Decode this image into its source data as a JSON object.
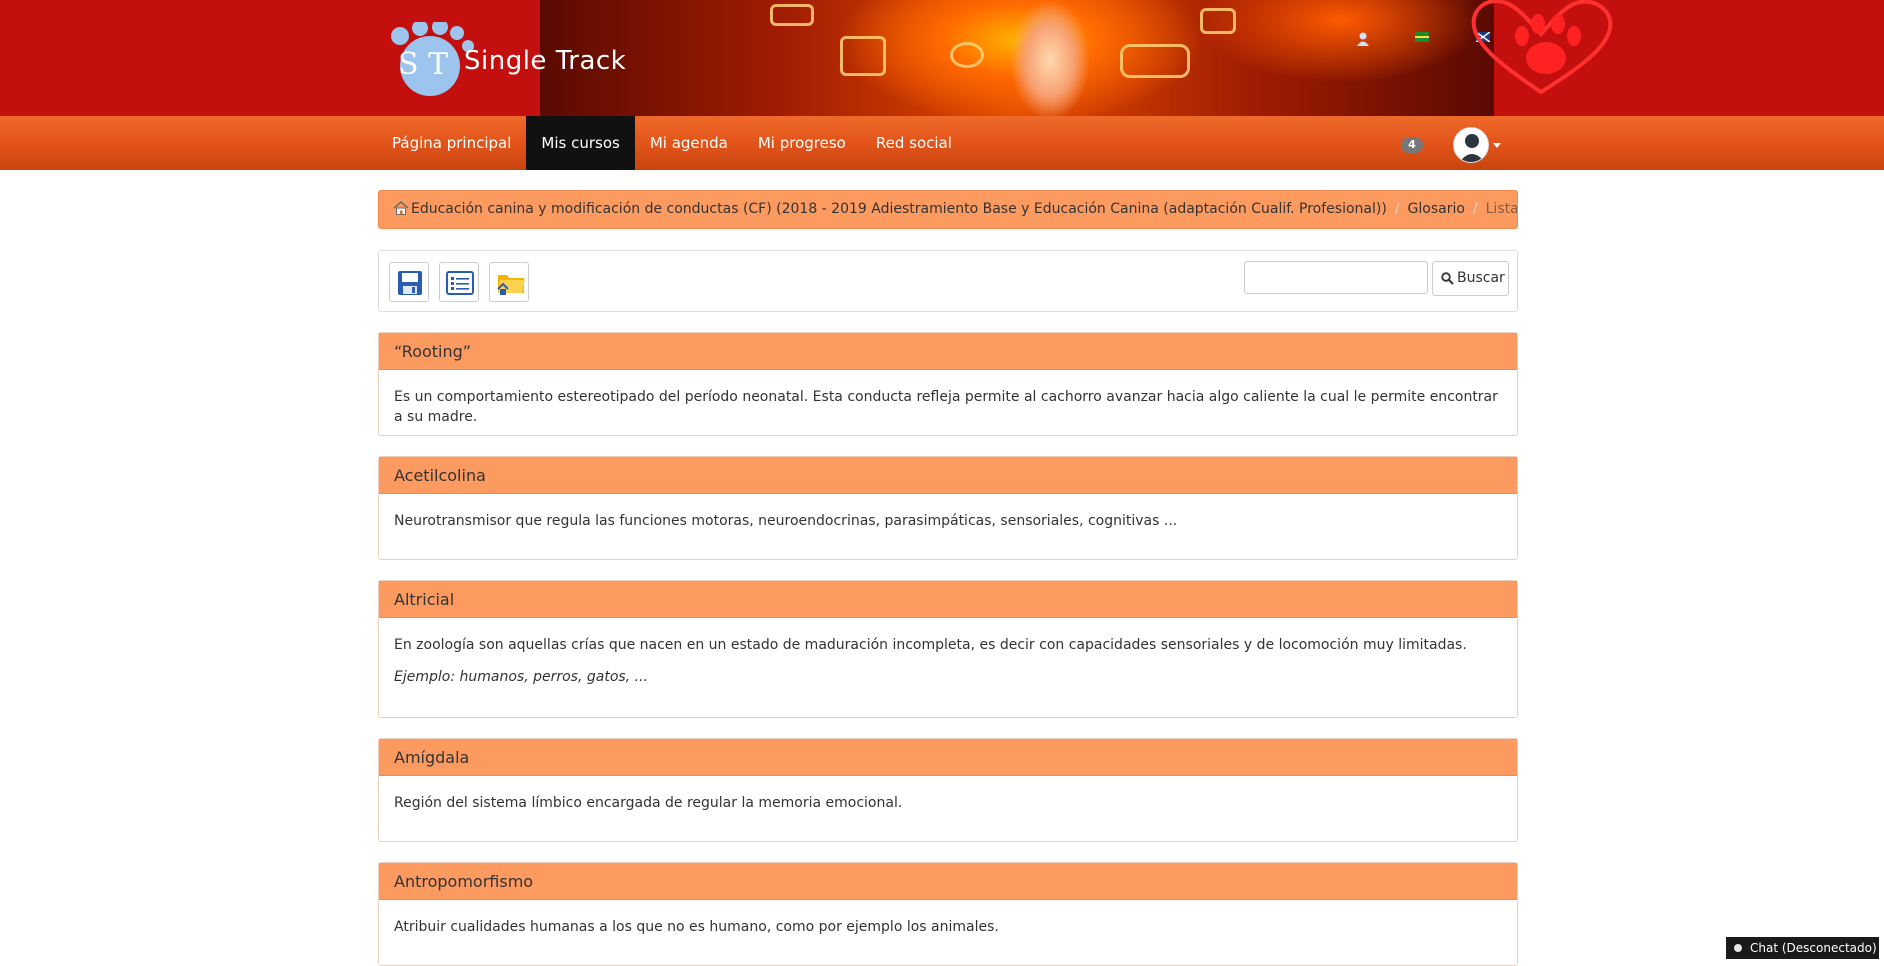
{
  "header": {
    "brand_name": "Single Track",
    "logo_letters": "S T",
    "icons": [
      "user-icon",
      "flag-es-icon",
      "flag-en-icon"
    ],
    "accent_color": "#c40f0f"
  },
  "nav": {
    "items": [
      {
        "label": "Página principal",
        "active": false
      },
      {
        "label": "Mis cursos",
        "active": true
      },
      {
        "label": "Mi agenda",
        "active": false
      },
      {
        "label": "Mi progreso",
        "active": false
      },
      {
        "label": "Red social",
        "active": false
      }
    ],
    "notifications_count": "4",
    "bar_color": "#e2541a"
  },
  "breadcrumb": {
    "course": "Educación canina y modificación de conductas (CF) (2018 - 2019 Adiestramiento Base y Educación Canina (adaptación Cualif. Profesional))",
    "section": "Glosario",
    "current": "Lista"
  },
  "toolbar": {
    "buttons": [
      "save-icon",
      "list-view-icon",
      "folder-home-icon"
    ],
    "search_value": "",
    "search_button": "Buscar"
  },
  "glossary": [
    {
      "term": "“Rooting”",
      "definition": "Es un comportamiento estereotipado del período neonatal. Esta conducta refleja permite al cachorro avanzar hacia algo caliente la cual le permite encontrar a su madre.",
      "example": ""
    },
    {
      "term": "Acetilcolina",
      "definition": "Neurotransmisor que regula las funciones motoras, neuroendocrinas, parasimpáticas, sensoriales, cognitivas ...",
      "example": ""
    },
    {
      "term": "Altricial",
      "definition": "En zoología son aquellas crías que nacen en un estado de maduración incompleta, es decir con capacidades sensoriales y de locomoción muy limitadas.",
      "example": "Ejemplo: humanos, perros, gatos, ..."
    },
    {
      "term": "Amígdala",
      "definition": "Región del sistema límbico encargada de regular la memoria emocional.",
      "example": ""
    },
    {
      "term": "Antropomorfismo",
      "definition": "Atribuir cualidades humanas a los que no es humano, como por ejemplo los animales.",
      "example": ""
    }
  ],
  "panel_color": "#fd9a60",
  "chat": {
    "label": "Chat (Desconectado)"
  }
}
